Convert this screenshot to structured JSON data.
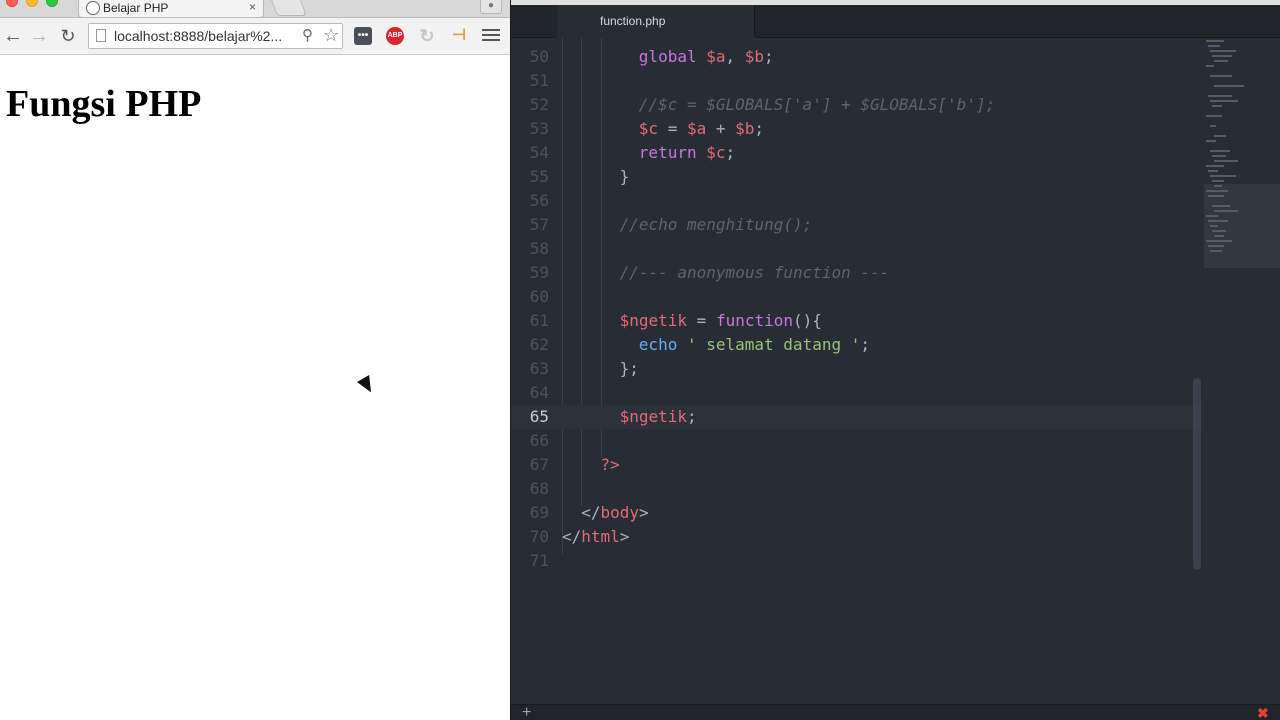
{
  "browser": {
    "tab_title": "Belajar PHP",
    "tab_close": "×",
    "url": "localhost:8888/belajar%2...",
    "ext_more": "•••",
    "ext_abp": "ABP",
    "page_heading": "Fungsi PHP"
  },
  "editor": {
    "tab_title": "function.php",
    "add_icon": "+",
    "close_icon": "✖",
    "colors": {
      "keyword": "#c678dd",
      "variable": "#e06c75",
      "function": "#61afef",
      "string": "#98c379",
      "comment": "#5c6370",
      "background": "#282c34"
    },
    "lines": [
      {
        "num": "50",
        "active": false,
        "tokens": [
          [
            "global",
            "kw"
          ],
          [
            " ",
            "pl"
          ],
          [
            "$a",
            "var"
          ],
          [
            ", ",
            "pl"
          ],
          [
            "$b",
            "var"
          ],
          [
            ";",
            "pl"
          ]
        ]
      },
      {
        "num": "51",
        "active": false,
        "tokens": []
      },
      {
        "num": "52",
        "active": false,
        "tokens": [
          [
            "//$c = $GLOBALS['a'] + $GLOBALS['b'];",
            "cm"
          ]
        ]
      },
      {
        "num": "53",
        "active": false,
        "tokens": [
          [
            "$c",
            "var"
          ],
          [
            " = ",
            "pl"
          ],
          [
            "$a",
            "var"
          ],
          [
            " + ",
            "pl"
          ],
          [
            "$b",
            "var"
          ],
          [
            ";",
            "pl"
          ]
        ]
      },
      {
        "num": "54",
        "active": false,
        "tokens": [
          [
            "return",
            "kw"
          ],
          [
            " ",
            "pl"
          ],
          [
            "$c",
            "var"
          ],
          [
            ";",
            "pl"
          ]
        ]
      },
      {
        "num": "55",
        "active": false,
        "tokens": [
          [
            "}",
            "pl"
          ]
        ]
      },
      {
        "num": "56",
        "active": false,
        "tokens": []
      },
      {
        "num": "57",
        "active": false,
        "tokens": [
          [
            "//echo menghitung();",
            "cm"
          ]
        ]
      },
      {
        "num": "58",
        "active": false,
        "tokens": []
      },
      {
        "num": "59",
        "active": false,
        "tokens": [
          [
            "//--- anonymous function ---",
            "cm"
          ]
        ]
      },
      {
        "num": "60",
        "active": false,
        "tokens": []
      },
      {
        "num": "61",
        "active": false,
        "tokens": [
          [
            "$ngetik",
            "var"
          ],
          [
            " = ",
            "pl"
          ],
          [
            "function",
            "kw"
          ],
          [
            "(){",
            "pl"
          ]
        ]
      },
      {
        "num": "62",
        "active": false,
        "tokens": [
          [
            "echo",
            "fn"
          ],
          [
            " ",
            "pl"
          ],
          [
            "' selamat datang '",
            "str"
          ],
          [
            ";",
            "pl"
          ]
        ]
      },
      {
        "num": "63",
        "active": false,
        "tokens": [
          [
            "};",
            "pl"
          ]
        ]
      },
      {
        "num": "64",
        "active": false,
        "tokens": []
      },
      {
        "num": "65",
        "active": true,
        "tokens": [
          [
            "$ngetik",
            "var"
          ],
          [
            ";",
            "pl"
          ]
        ]
      },
      {
        "num": "66",
        "active": false,
        "tokens": []
      },
      {
        "num": "67",
        "active": false,
        "tokens": [
          [
            "?>",
            "var"
          ]
        ]
      },
      {
        "num": "68",
        "active": false,
        "tokens": []
      },
      {
        "num": "69",
        "active": false,
        "tokens": [
          [
            "</",
            "pl"
          ],
          [
            "body",
            "var"
          ],
          [
            ">",
            "pl"
          ]
        ]
      },
      {
        "num": "70",
        "active": false,
        "tokens": [
          [
            "</",
            "pl"
          ],
          [
            "html",
            "var"
          ],
          [
            ">",
            "pl"
          ]
        ]
      },
      {
        "num": "71",
        "active": false,
        "tokens": []
      }
    ]
  }
}
